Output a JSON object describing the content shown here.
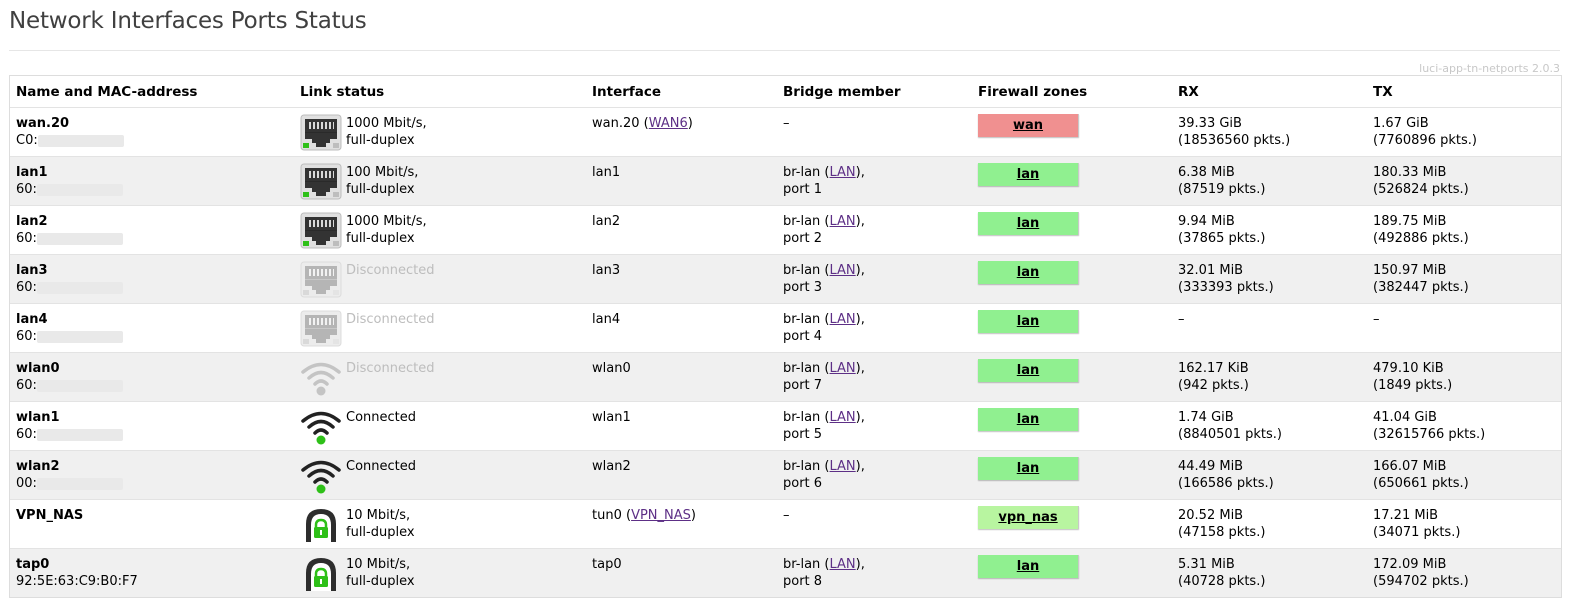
{
  "page": {
    "title": "Network Interfaces Ports Status",
    "version": "luci-app-tn-netports 2.0.3"
  },
  "columns": {
    "name": "Name and MAC-address",
    "link": "Link status",
    "iface": "Interface",
    "bridge": "Bridge member",
    "firewall": "Firewall zones",
    "rx": "RX",
    "tx": "TX"
  },
  "colors": {
    "zone_wan": "#f09090",
    "zone_lan": "#90f090",
    "zone_vpn": "#b8f5a0",
    "link_green": "#2ec018",
    "link_dim": "#bdbdbd",
    "link_color": "#5d2f86"
  },
  "rows": [
    {
      "name": "wan.20",
      "mac": "C0:",
      "icon": "ethernet-port-icon",
      "state": "up",
      "link": [
        "1000 Mbit/s,",
        "full-duplex"
      ],
      "iface": "wan.20",
      "iface_link": "WAN6",
      "bridge": "–",
      "bridge_link": "",
      "bridge_port": "",
      "zone": "wan",
      "zone_color": "#f09090",
      "rx": [
        "39.33 GiB",
        "(18536560 pkts.)"
      ],
      "tx": [
        "1.67 GiB",
        "(7760896 pkts.)"
      ]
    },
    {
      "name": "lan1",
      "mac": "60:",
      "icon": "ethernet-port-icon",
      "state": "up",
      "link": [
        "100 Mbit/s,",
        "full-duplex"
      ],
      "iface": "lan1",
      "iface_link": "",
      "bridge": "br-lan",
      "bridge_link": "LAN",
      "bridge_port": "port 1",
      "zone": "lan",
      "zone_color": "#90f090",
      "rx": [
        "6.38 MiB",
        "(87519 pkts.)"
      ],
      "tx": [
        "180.33 MiB",
        "(526824 pkts.)"
      ]
    },
    {
      "name": "lan2",
      "mac": "60:",
      "icon": "ethernet-port-icon",
      "state": "up",
      "link": [
        "1000 Mbit/s,",
        "full-duplex"
      ],
      "iface": "lan2",
      "iface_link": "",
      "bridge": "br-lan",
      "bridge_link": "LAN",
      "bridge_port": "port 2",
      "zone": "lan",
      "zone_color": "#90f090",
      "rx": [
        "9.94 MiB",
        "(37865 pkts.)"
      ],
      "tx": [
        "189.75 MiB",
        "(492886 pkts.)"
      ]
    },
    {
      "name": "lan3",
      "mac": "60:",
      "icon": "ethernet-port-icon",
      "state": "down",
      "link": [
        "Disconnected",
        ""
      ],
      "iface": "lan3",
      "iface_link": "",
      "bridge": "br-lan",
      "bridge_link": "LAN",
      "bridge_port": "port 3",
      "zone": "lan",
      "zone_color": "#90f090",
      "rx": [
        "32.01 MiB",
        "(333393 pkts.)"
      ],
      "tx": [
        "150.97 MiB",
        "(382447 pkts.)"
      ]
    },
    {
      "name": "lan4",
      "mac": "60:",
      "icon": "ethernet-port-icon",
      "state": "down",
      "link": [
        "Disconnected",
        ""
      ],
      "iface": "lan4",
      "iface_link": "",
      "bridge": "br-lan",
      "bridge_link": "LAN",
      "bridge_port": "port 4",
      "zone": "lan",
      "zone_color": "#90f090",
      "rx": [
        "–",
        ""
      ],
      "tx": [
        "–",
        ""
      ]
    },
    {
      "name": "wlan0",
      "mac": "60:",
      "icon": "wifi-icon",
      "state": "down",
      "link": [
        "Disconnected",
        ""
      ],
      "iface": "wlan0",
      "iface_link": "",
      "bridge": "br-lan",
      "bridge_link": "LAN",
      "bridge_port": "port 7",
      "zone": "lan",
      "zone_color": "#90f090",
      "rx": [
        "162.17 KiB",
        "(942 pkts.)"
      ],
      "tx": [
        "479.10 KiB",
        "(1849 pkts.)"
      ]
    },
    {
      "name": "wlan1",
      "mac": "60:",
      "icon": "wifi-icon",
      "state": "up",
      "link": [
        "Connected",
        ""
      ],
      "iface": "wlan1",
      "iface_link": "",
      "bridge": "br-lan",
      "bridge_link": "LAN",
      "bridge_port": "port 5",
      "zone": "lan",
      "zone_color": "#90f090",
      "rx": [
        "1.74 GiB",
        "(8840501 pkts.)"
      ],
      "tx": [
        "41.04 GiB",
        "(32615766 pkts.)"
      ]
    },
    {
      "name": "wlan2",
      "mac": "00:",
      "icon": "wifi-icon",
      "state": "up",
      "link": [
        "Connected",
        ""
      ],
      "iface": "wlan2",
      "iface_link": "",
      "bridge": "br-lan",
      "bridge_link": "LAN",
      "bridge_port": "port 6",
      "zone": "lan",
      "zone_color": "#90f090",
      "rx": [
        "44.49 MiB",
        "(166586 pkts.)"
      ],
      "tx": [
        "166.07 MiB",
        "(650661 pkts.)"
      ]
    },
    {
      "name": "VPN_NAS",
      "mac": "",
      "icon": "vpn-tunnel-icon",
      "state": "up",
      "link": [
        "10 Mbit/s,",
        "full-duplex"
      ],
      "iface": "tun0",
      "iface_link": "VPN_NAS",
      "bridge": "–",
      "bridge_link": "",
      "bridge_port": "",
      "zone": "vpn_nas",
      "zone_color": "#b8f5a0",
      "rx": [
        "20.52 MiB",
        "(47158 pkts.)"
      ],
      "tx": [
        "17.21 MiB",
        "(34071 pkts.)"
      ]
    },
    {
      "name": "tap0",
      "mac": "92:5E:63:C9:B0:F7",
      "icon": "vpn-tunnel-icon",
      "state": "up",
      "link": [
        "10 Mbit/s,",
        "full-duplex"
      ],
      "iface": "tap0",
      "iface_link": "",
      "bridge": "br-lan",
      "bridge_link": "LAN",
      "bridge_port": "port 8",
      "zone": "lan",
      "zone_color": "#90f090",
      "rx": [
        "5.31 MiB",
        "(40728 pkts.)"
      ],
      "tx": [
        "172.09 MiB",
        "(594702 pkts.)"
      ]
    }
  ]
}
